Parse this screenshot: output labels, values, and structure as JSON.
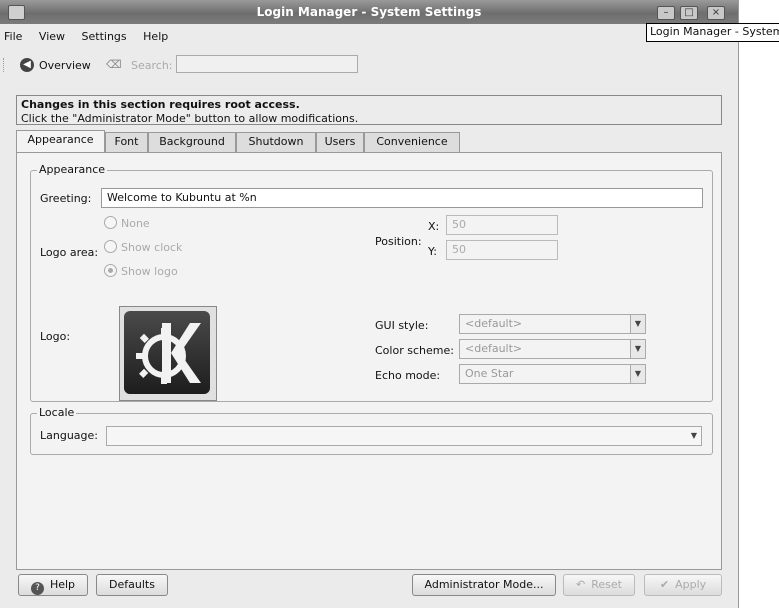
{
  "window": {
    "title": "Login Manager - System Settings",
    "tooltip": "Login Manager - System"
  },
  "menubar": [
    "File",
    "View",
    "Settings",
    "Help"
  ],
  "toolbar": {
    "overview_label": "Overview",
    "search_label": "Search:",
    "search_value": ""
  },
  "notice": {
    "title": "Changes in this section requires root access.",
    "body": "Click the \"Administrator Mode\" button to allow modifications."
  },
  "tabs": [
    "Appearance",
    "Font",
    "Background",
    "Shutdown",
    "Users",
    "Convenience"
  ],
  "appearance": {
    "legend": "Appearance",
    "greeting_label": "Greeting:",
    "greeting_value": "Welcome to Kubuntu at %n",
    "logo_area_label": "Logo area:",
    "logo_options": [
      "None",
      "Show clock",
      "Show logo"
    ],
    "logo_selected": "Show logo",
    "position_label": "Position:",
    "x_label": "X:",
    "x_value": "50",
    "y_label": "Y:",
    "y_value": "50",
    "logo_label": "Logo:",
    "gui_style_label": "GUI style:",
    "gui_style_value": "<default>",
    "color_scheme_label": "Color scheme:",
    "color_scheme_value": "<default>",
    "echo_mode_label": "Echo mode:",
    "echo_mode_value": "One Star"
  },
  "locale": {
    "legend": "Locale",
    "language_label": "Language:",
    "language_value": ""
  },
  "buttons": {
    "help": "Help",
    "defaults": "Defaults",
    "admin": "Administrator Mode...",
    "reset": "Reset",
    "apply": "Apply"
  }
}
